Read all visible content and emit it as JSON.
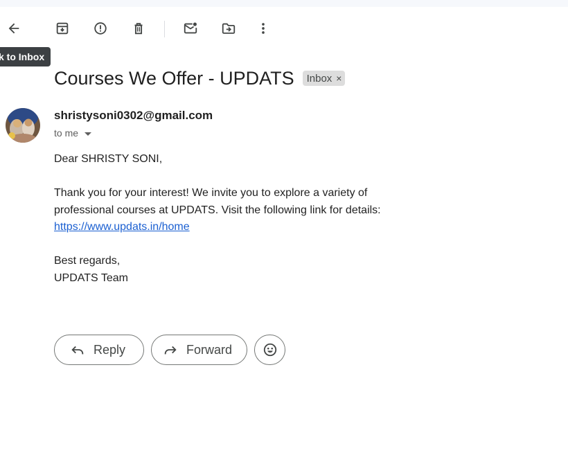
{
  "toolbar": {
    "icons": [
      "back-arrow-icon",
      "archive-icon",
      "report-spam-icon",
      "delete-icon",
      "mark-unread-icon",
      "move-to-icon",
      "more-options-icon"
    ]
  },
  "tooltip": {
    "text": "k to Inbox"
  },
  "email": {
    "subject": "Courses We Offer - UPDATS",
    "label": "Inbox",
    "label_remove": "×",
    "sender": "shristysoni0302@gmail.com",
    "recipient": "to me",
    "greeting": "Dear SHRISTY SONI,",
    "paragraph_line1": "Thank you for your interest! We invite you to explore a variety of",
    "paragraph_line2": "professional courses at UPDATS. Visit the following link for details:",
    "link": "https://www.updats.in/home",
    "closing": "Best regards,",
    "signature": "UPDATS Team"
  },
  "actions": {
    "reply_label": "Reply",
    "forward_label": "Forward"
  },
  "colors": {
    "link": "#1a5fd1",
    "tooltip_bg": "#3c4043",
    "chip_bg": "#dddddd"
  }
}
